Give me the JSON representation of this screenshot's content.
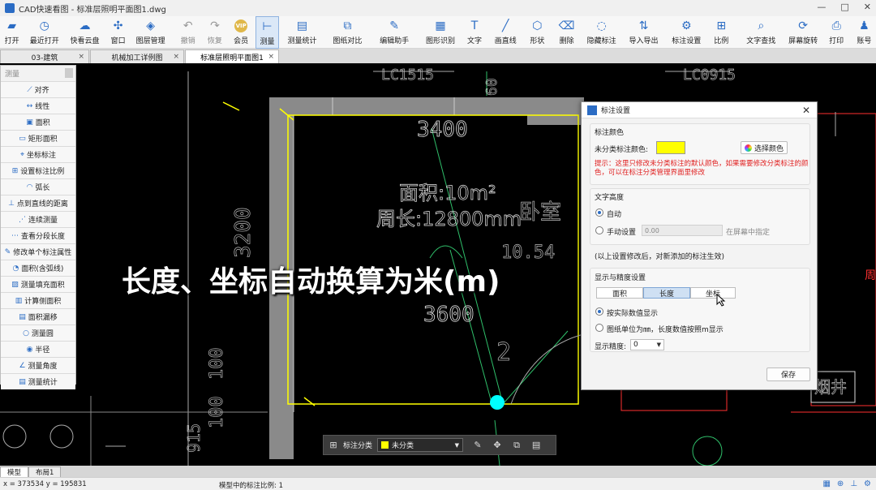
{
  "window": {
    "title": "CAD快速看图 - 标准层照明平面图1.dwg",
    "min": "—",
    "max": "□",
    "close": "✕"
  },
  "ribbon": [
    {
      "label": "打开",
      "icon": "folder-icon",
      "glyph": "▰"
    },
    {
      "label": "最近打开",
      "icon": "clock-icon",
      "glyph": "◷"
    },
    {
      "label": "快看云盘",
      "icon": "cloud-icon",
      "glyph": "☁"
    },
    {
      "label": "窗口",
      "icon": "window-icon",
      "glyph": "✣"
    },
    {
      "label": "图层管理",
      "icon": "layers-icon",
      "glyph": "◈"
    },
    {
      "label": "撤销",
      "icon": "undo-icon",
      "glyph": "↶",
      "gray": true
    },
    {
      "label": "恢复",
      "icon": "redo-icon",
      "glyph": "↷",
      "gray": true
    },
    {
      "label": "会员",
      "icon": "vip-icon",
      "glyph": "VIP",
      "vip": true
    },
    {
      "label": "测量",
      "icon": "measure-icon",
      "glyph": "⊢",
      "active": true
    },
    {
      "label": "测量统计",
      "icon": "measure-stats-icon",
      "glyph": "▤"
    },
    {
      "label": "图纸对比",
      "icon": "compare-icon",
      "glyph": "⧉"
    },
    {
      "label": "编辑助手",
      "icon": "edit-assistant-icon",
      "glyph": "✎"
    },
    {
      "label": "图形识别",
      "icon": "shape-recognition-icon",
      "glyph": "▦"
    },
    {
      "label": "文字",
      "icon": "text-icon",
      "glyph": "T"
    },
    {
      "label": "画直线",
      "icon": "line-icon",
      "glyph": "╱"
    },
    {
      "label": "形状",
      "icon": "shape-icon",
      "glyph": "⬡"
    },
    {
      "label": "删除",
      "icon": "eraser-icon",
      "glyph": "⌫"
    },
    {
      "label": "隐藏标注",
      "icon": "hide-annotation-icon",
      "glyph": "◌"
    },
    {
      "label": "导入导出",
      "icon": "import-export-icon",
      "glyph": "⇅"
    },
    {
      "label": "标注设置",
      "icon": "annotation-settings-icon",
      "glyph": "⚙"
    },
    {
      "label": "比例",
      "icon": "scale-icon",
      "glyph": "⊞"
    },
    {
      "label": "文字查找",
      "icon": "text-search-icon",
      "glyph": "⌕"
    },
    {
      "label": "屏幕旋转",
      "icon": "rotate-screen-icon",
      "glyph": "⟳"
    },
    {
      "label": "打印",
      "icon": "print-icon",
      "glyph": "⎙"
    },
    {
      "label": "账号",
      "icon": "user-icon",
      "glyph": "♟"
    }
  ],
  "tabs": [
    {
      "label": "03-建筑",
      "active": false
    },
    {
      "label": "机械加工详例图",
      "active": false
    },
    {
      "label": "标准层照明平面图1",
      "active": true
    }
  ],
  "tab_close": "×",
  "measure_panel": {
    "header": "测量",
    "items": [
      {
        "label": "对齐",
        "icon": "align-icon",
        "glyph": "⟋"
      },
      {
        "label": "线性",
        "icon": "linear-icon",
        "glyph": "↔"
      },
      {
        "label": "面积",
        "icon": "area-icon",
        "glyph": "▣"
      },
      {
        "label": "矩形面积",
        "icon": "rect-area-icon",
        "glyph": "▭"
      },
      {
        "label": "坐标标注",
        "icon": "coordinate-icon",
        "glyph": "⌖"
      },
      {
        "label": "设置标注比例",
        "icon": "set-scale-icon",
        "glyph": "⊞"
      },
      {
        "label": "弧长",
        "icon": "arc-icon",
        "glyph": "◠"
      },
      {
        "label": "点到直线的距离",
        "icon": "point-line-icon",
        "glyph": "⊥"
      },
      {
        "label": "连续测量",
        "icon": "continuous-icon",
        "glyph": "⋰"
      },
      {
        "label": "查看分段长度",
        "icon": "segment-icon",
        "glyph": "⋯"
      },
      {
        "label": "修改单个标注属性",
        "icon": "modify-annotation-icon",
        "glyph": "✎"
      },
      {
        "label": "面积(含弧线)",
        "icon": "arc-area-icon",
        "glyph": "◔"
      },
      {
        "label": "测量填充面积",
        "icon": "fill-area-icon",
        "glyph": "▨"
      },
      {
        "label": "计算侧面积",
        "icon": "side-area-icon",
        "glyph": "▥"
      },
      {
        "label": "面积漏移",
        "icon": "area-offset-icon",
        "glyph": "▤"
      },
      {
        "label": "测量圆",
        "icon": "circle-icon",
        "glyph": "○"
      },
      {
        "label": "半径",
        "icon": "radius-icon",
        "glyph": "◉"
      },
      {
        "label": "测量角度",
        "icon": "angle-icon",
        "glyph": "∠"
      },
      {
        "label": "测量统计",
        "icon": "stats-icon",
        "glyph": "▤"
      }
    ]
  },
  "drawing": {
    "labels_top": [
      "LC1515",
      "60",
      "LC0915"
    ],
    "width_label": "3400",
    "area_text": "面积:10m²",
    "perimeter_text": "周长:12800mm",
    "room_text": "卧室",
    "level_text": "10.54",
    "height_label": "3200",
    "bottom_label": "3600",
    "num_label": "2",
    "left_labels": [
      "100",
      "100"
    ],
    "side_label_right": "周",
    "room_right": "烟井",
    "left_bottom_label": "915",
    "bottom_left_label": "915"
  },
  "caption": "长度、坐标自动换算为米(m)",
  "dialog": {
    "title": "标注设置",
    "close": "✕",
    "color_section": "标注颜色",
    "color_label": "未分类标注颜色:",
    "choose_color": "选择颜色",
    "tip": "提示：这里只修改未分类标注的默认颜色，如果需要修改分类标注的颜色，可以在标注分类管理界面里修改",
    "text_height_section": "文字高度",
    "auto": "自动",
    "manual": "手动设置",
    "manual_value": "0.00",
    "screen_specify": "在屏幕中指定",
    "note": "(以上设置修改后，对新添加的标注生效)",
    "precision_section": "显示与精度设置",
    "segments": [
      {
        "label": "面积",
        "active": false
      },
      {
        "label": "长度",
        "active": true
      },
      {
        "label": "坐标",
        "active": false
      }
    ],
    "opt_actual": "按实际数值显示",
    "opt_unit": "图纸单位为㎜，长度数值按照m显示",
    "precision_label": "显示精度:",
    "precision_value": "0",
    "save": "保存"
  },
  "floatbar": {
    "label": "标注分类",
    "category": "未分类"
  },
  "bottom_tabs": [
    "模型",
    "布局1"
  ],
  "status": {
    "coords": "x = 373534  y = 195831",
    "scale_text": "模型中的标注比例: 1"
  }
}
